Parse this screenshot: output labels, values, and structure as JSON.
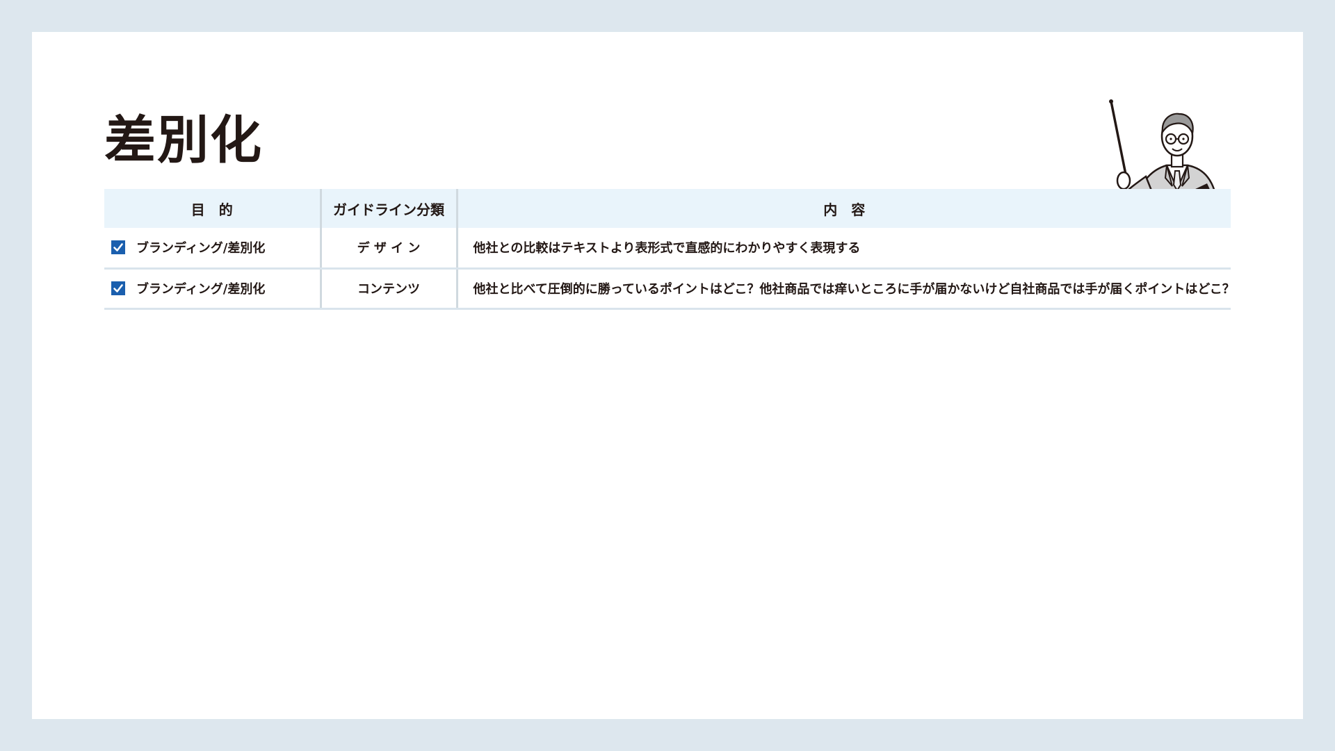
{
  "slide": {
    "title": "差別化"
  },
  "table": {
    "headers": {
      "purpose": "目　的",
      "category": "ガイドライン分類",
      "content": "内　容"
    },
    "rows": [
      {
        "checked": true,
        "purpose": "ブランディング/差別化",
        "category": "デ ザ イ ン",
        "content": "他社との比較はテキストより表形式で直感的にわかりやすく表現する"
      },
      {
        "checked": true,
        "purpose": "ブランディング/差別化",
        "category": "コンテンツ",
        "content": "他社と比べて圧倒的に勝っているポイントはどこ？他社商品では痒いところに手が届かないけど自社商品では手が届くポイントはどこ？"
      }
    ]
  },
  "colors": {
    "page_bg": "#dde7ee",
    "header_bg": "#e9f4fb",
    "checkbox": "#1a5fae",
    "text": "#231815"
  },
  "icons": {
    "teacher": "teacher-with-pointer-illustration",
    "checkbox": "checkbox-checked-icon"
  }
}
